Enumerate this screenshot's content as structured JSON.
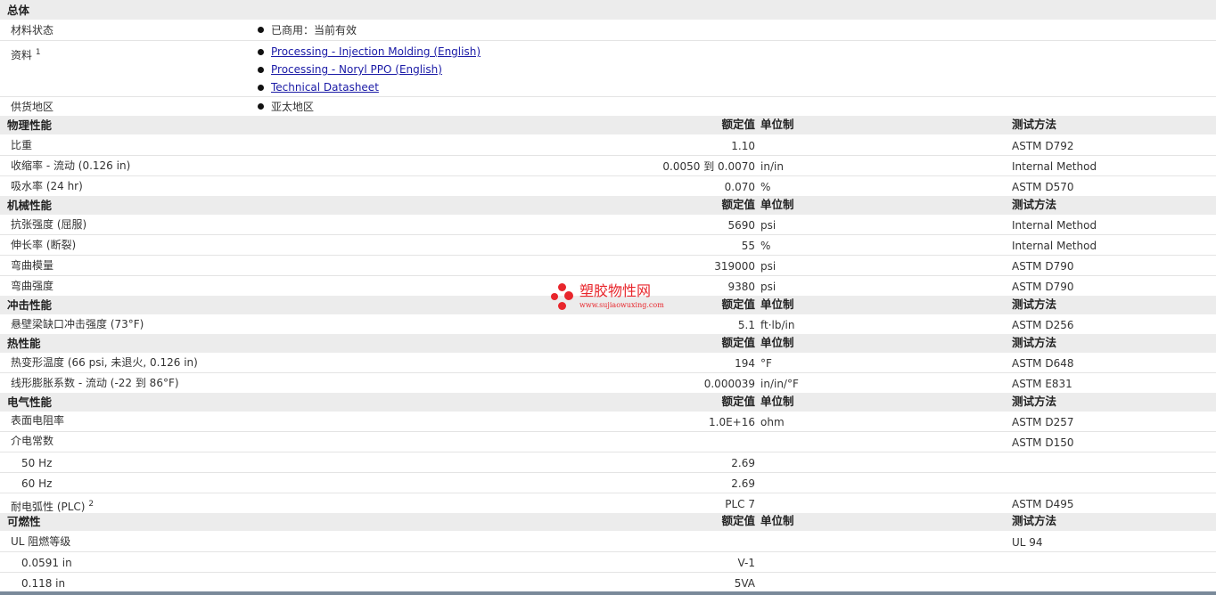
{
  "overall": {
    "title": "总体",
    "material_status_label": "材料状态",
    "material_status_value": "已商用：当前有效",
    "docs_label": "资料",
    "docs_sup": "1",
    "docs": [
      "Processing - Injection Molding (English)",
      "Processing - Noryl PPO (English)",
      "Technical Datasheet"
    ],
    "supply_label": "供货地区",
    "supply_value": "亚太地区"
  },
  "headers": {
    "rated": "额定值",
    "unit": "单位制",
    "method": "测试方法"
  },
  "physical": {
    "title": "物理性能",
    "rows": [
      {
        "name": "比重",
        "value": "1.10",
        "unit": "",
        "method": "ASTM D792"
      },
      {
        "name": "收缩率 - 流动 (0.126 in)",
        "value": "0.0050 到 0.0070",
        "unit": "in/in",
        "method": "Internal Method"
      },
      {
        "name": "吸水率 (24 hr)",
        "value": "0.070",
        "unit": "%",
        "method": "ASTM D570"
      }
    ]
  },
  "mechanical": {
    "title": "机械性能",
    "rows": [
      {
        "name": "抗张强度 (屈服)",
        "value": "5690",
        "unit": "psi",
        "method": "Internal Method"
      },
      {
        "name": "伸长率 (断裂)",
        "value": "55",
        "unit": "%",
        "method": "Internal Method"
      },
      {
        "name": "弯曲模量",
        "value": "319000",
        "unit": "psi",
        "method": "ASTM D790"
      },
      {
        "name": "弯曲强度",
        "value": "9380",
        "unit": "psi",
        "method": "ASTM D790"
      }
    ]
  },
  "impact": {
    "title": "冲击性能",
    "rows": [
      {
        "name": "悬壁梁缺口冲击强度 (73°F)",
        "value": "5.1",
        "unit": "ft·lb/in",
        "method": "ASTM D256"
      }
    ]
  },
  "thermal": {
    "title": "热性能",
    "rows": [
      {
        "name": "热变形温度 (66 psi, 未退火, 0.126 in)",
        "value": "194",
        "unit": "°F",
        "method": "ASTM D648"
      },
      {
        "name": "线形膨胀系数 - 流动 (-22 到 86°F)",
        "value": "0.000039",
        "unit": "in/in/°F",
        "method": "ASTM E831"
      }
    ]
  },
  "electrical": {
    "title": "电气性能",
    "rows": [
      {
        "name": "表面电阻率",
        "value": "1.0E+16",
        "unit": "ohm",
        "method": "ASTM D257"
      },
      {
        "name": "介电常数",
        "value": "",
        "unit": "",
        "method": "ASTM D150"
      },
      {
        "name": "50 Hz",
        "value": "2.69",
        "unit": "",
        "method": ""
      },
      {
        "name": "60 Hz",
        "value": "2.69",
        "unit": "",
        "method": ""
      },
      {
        "name": "耐电弧性 (PLC)",
        "sup": "2",
        "value": "PLC 7",
        "unit": "",
        "method": "ASTM D495"
      }
    ]
  },
  "flammability": {
    "title": "可燃性",
    "rows": [
      {
        "name": "UL 阻燃等级",
        "value": "",
        "unit": "",
        "method": "UL 94"
      },
      {
        "name": "0.0591 in",
        "value": "V-1",
        "unit": "",
        "method": ""
      },
      {
        "name": "0.118 in",
        "value": "5VA",
        "unit": "",
        "method": ""
      }
    ]
  },
  "watermark": {
    "name": "塑胶物性网",
    "url": "www.sujiaowuxing.com",
    "color": "#e8262c"
  }
}
